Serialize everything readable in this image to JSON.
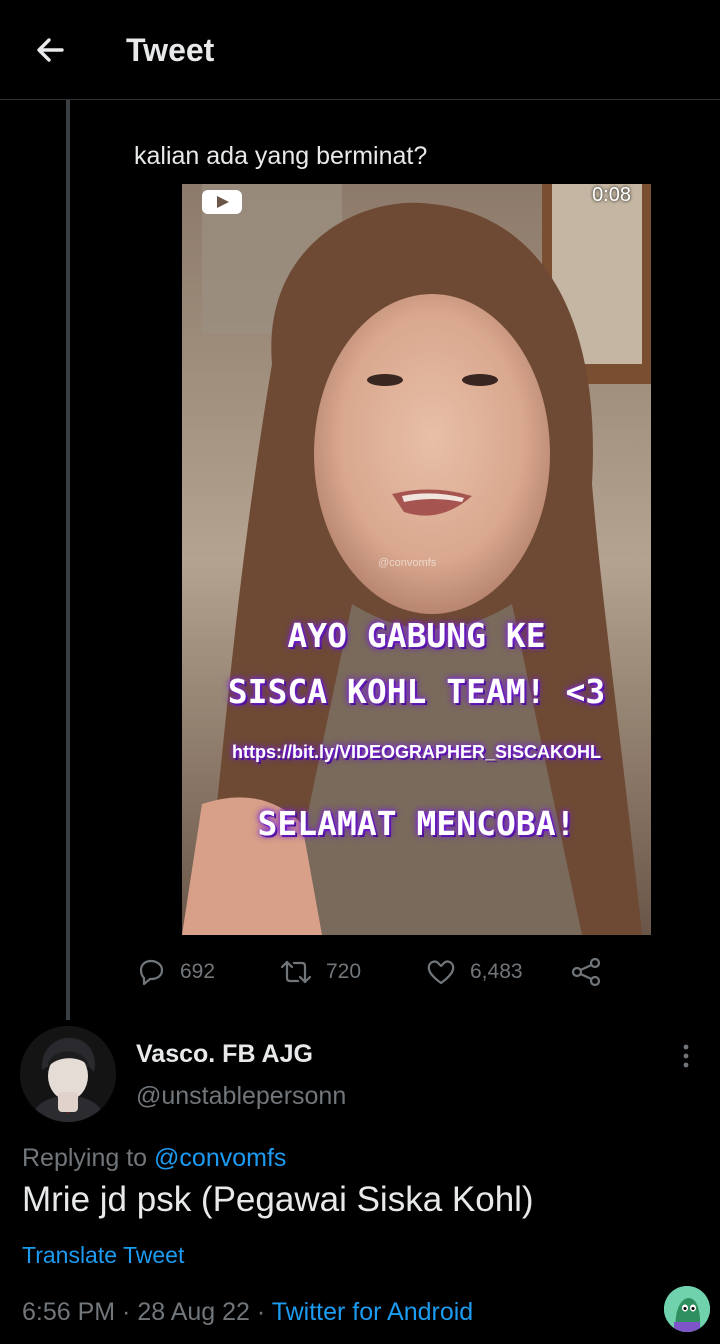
{
  "header": {
    "title": "Tweet",
    "back_icon": "arrow-left-icon"
  },
  "parent_tweet": {
    "text": "kalian ada yang berminat?",
    "video": {
      "duration": "0:08",
      "watermark": "@convomfs",
      "overlay_line1": "AYO GABUNG KE",
      "overlay_line2": "SISCA KOHL TEAM! <3",
      "overlay_url": "https://bit.ly/VIDEOGRAPHER_SISCAKOHL",
      "overlay_line3": "SELAMAT MENCOBA!"
    },
    "actions": {
      "replies": "692",
      "retweets": "720",
      "likes": "6,483"
    }
  },
  "reply": {
    "display_name": "Vasco. FB AJG",
    "handle": "@unstablepersonn",
    "replying_prefix": "Replying to ",
    "replying_to": "@convomfs",
    "text": "Mrie jd psk (Pegawai Siska Kohl)",
    "translate_label": "Translate Tweet",
    "time": "6:56 PM",
    "separator": " · ",
    "date": "28 Aug 22",
    "source": "Twitter for Android"
  },
  "colors": {
    "background": "#000000",
    "text": "#e7e9ea",
    "muted": "#71767b",
    "accent": "#1d9bf0"
  }
}
